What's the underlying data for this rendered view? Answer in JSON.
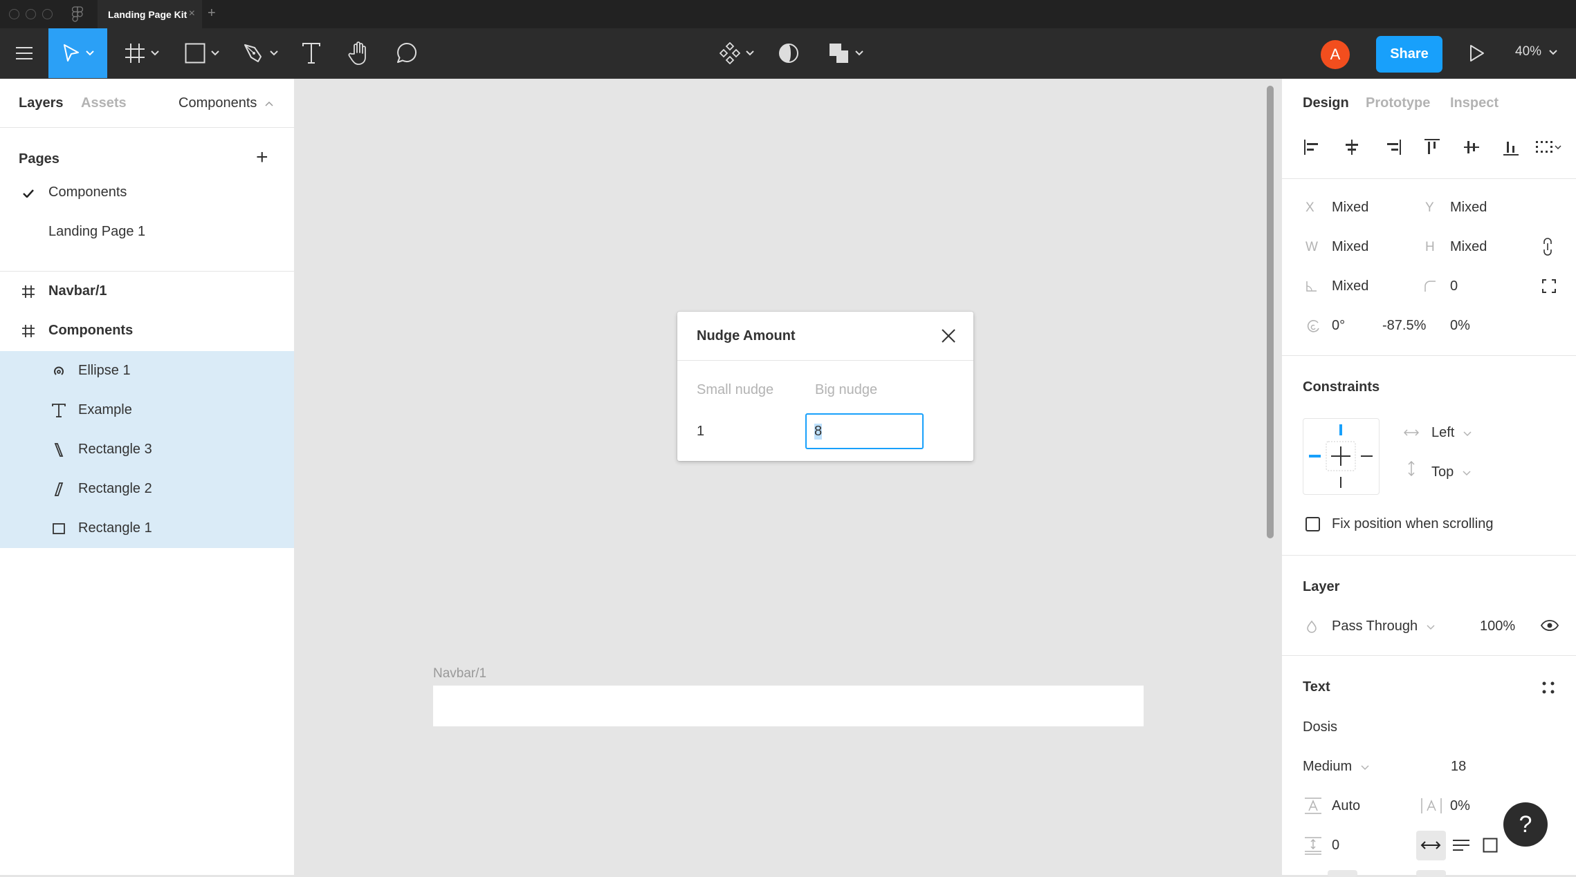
{
  "window": {
    "tab_title": "Landing Page Kit",
    "tab_close": "×",
    "new_tab": "+"
  },
  "toolbar": {
    "tools": [
      {
        "name": "main-menu",
        "icon": "hamburger-icon"
      },
      {
        "name": "move-tool",
        "icon": "cursor-arrow-icon",
        "active": true,
        "has_dropdown": true
      },
      {
        "name": "frame-tool",
        "icon": "frame-hash-icon",
        "has_dropdown": true
      },
      {
        "name": "shape-tool",
        "icon": "rectangle-icon",
        "has_dropdown": true
      },
      {
        "name": "pen-tool",
        "icon": "pen-nib-icon",
        "has_dropdown": true
      },
      {
        "name": "text-tool",
        "icon": "text-t-icon"
      },
      {
        "name": "hand-tool",
        "icon": "hand-icon"
      },
      {
        "name": "comment-tool",
        "icon": "speech-bubble-icon"
      }
    ],
    "center_tools": [
      {
        "name": "components",
        "icon": "component-diamonds-icon",
        "has_dropdown": true
      },
      {
        "name": "mask",
        "icon": "half-circle-icon"
      },
      {
        "name": "boolean-ops",
        "icon": "boolean-union-icon",
        "has_dropdown": true
      }
    ],
    "avatar_initial": "A",
    "share_label": "Share",
    "present_icon": "play-triangle-icon",
    "zoom_level": "40%",
    "accent_color": "#18a0fb",
    "avatar_color": "#f24e1e"
  },
  "left_panel": {
    "tabs": {
      "layers": "Layers",
      "assets": "Assets"
    },
    "page_dropdown": "Components",
    "pages_title": "Pages",
    "add_page": "+",
    "pages": [
      {
        "label": "Components",
        "current": true
      },
      {
        "label": "Landing Page 1",
        "current": false
      }
    ],
    "layers": [
      {
        "label": "Navbar/1",
        "icon": "frame-hash-icon",
        "bold": true,
        "indent": 0,
        "selected": false
      },
      {
        "label": "Components",
        "icon": "frame-hash-icon",
        "bold": true,
        "indent": 0,
        "selected": false
      },
      {
        "label": "Ellipse 1",
        "icon": "ellipse-arc-icon",
        "bold": false,
        "indent": 1,
        "selected": true
      },
      {
        "label": "Example",
        "icon": "text-t-icon",
        "bold": false,
        "indent": 1,
        "selected": true
      },
      {
        "label": "Rectangle 3",
        "icon": "skewed-rect-left-icon",
        "bold": false,
        "indent": 1,
        "selected": true
      },
      {
        "label": "Rectangle 2",
        "icon": "skewed-rect-right-icon",
        "bold": false,
        "indent": 1,
        "selected": true
      },
      {
        "label": "Rectangle 1",
        "icon": "rectangle-icon",
        "bold": false,
        "indent": 1,
        "selected": true
      }
    ]
  },
  "canvas": {
    "frame_label": "Navbar/1"
  },
  "dialog": {
    "title": "Nudge Amount",
    "small_nudge_label": "Small nudge",
    "big_nudge_label": "Big nudge",
    "small_nudge_value": "1",
    "big_nudge_value": "8"
  },
  "right_panel": {
    "tabs": {
      "design": "Design",
      "prototype": "Prototype",
      "inspect": "Inspect"
    },
    "transform": {
      "x_label": "X",
      "x_value": "Mixed",
      "y_label": "Y",
      "y_value": "Mixed",
      "w_label": "W",
      "w_value": "Mixed",
      "h_label": "H",
      "h_value": "Mixed",
      "rotation_value": "Mixed",
      "radius_value": "0",
      "arc_start": "0°",
      "arc_sweep": "-87.5%",
      "arc_ratio": "0%"
    },
    "constraints": {
      "title": "Constraints",
      "horizontal": "Left",
      "vertical": "Top",
      "fix_position_label": "Fix position when scrolling",
      "fix_position_checked": false
    },
    "layer": {
      "title": "Layer",
      "blend_mode": "Pass Through",
      "opacity": "100%"
    },
    "text": {
      "title": "Text",
      "font_family": "Dosis",
      "font_weight": "Medium",
      "font_size": "18",
      "line_height": "Auto",
      "letter_spacing": "0%",
      "paragraph_spacing": "0"
    },
    "help": "?"
  }
}
